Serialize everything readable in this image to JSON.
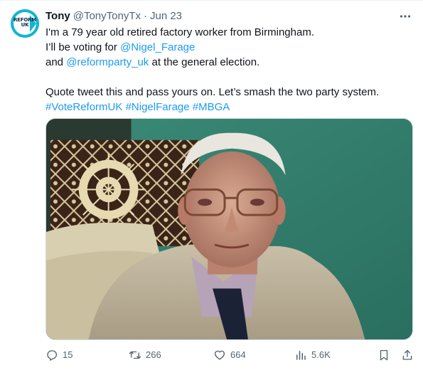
{
  "tweet": {
    "author_name": "Tony",
    "author_handle": "@TonyTonyTx",
    "separator": "·",
    "date": "Jun 23",
    "avatar_text_line1": "REFORM",
    "avatar_text_line2": "UK",
    "body": {
      "line1": "I'm a 79 year old retired factory worker from Birmingham.",
      "line2_prefix": "I’ll be voting for ",
      "line2_mention": "@Nigel_Farage",
      "line3_prefix": "and ",
      "line3_mention": "@reformparty_uk",
      "line3_suffix": " at the general election.",
      "line4": "Quote tweet this and pass yours on. Let’s smash the two party system.",
      "hashtags": [
        "#VoteReformUK",
        "#NigelFarage",
        "#MBGA"
      ]
    },
    "media_icon": "photo-elderly-man-icon",
    "actions": {
      "reply_count": "15",
      "retweet_count": "266",
      "like_count": "664",
      "view_count": "5.6K"
    },
    "icons": [
      "reply-icon",
      "retweet-icon",
      "like-icon",
      "views-icon",
      "bookmark-icon",
      "share-icon",
      "more-icon"
    ],
    "colors": {
      "link": "#1d9bf0",
      "secondary_text": "#536471",
      "avatar_bg": "#12b6cf"
    }
  }
}
